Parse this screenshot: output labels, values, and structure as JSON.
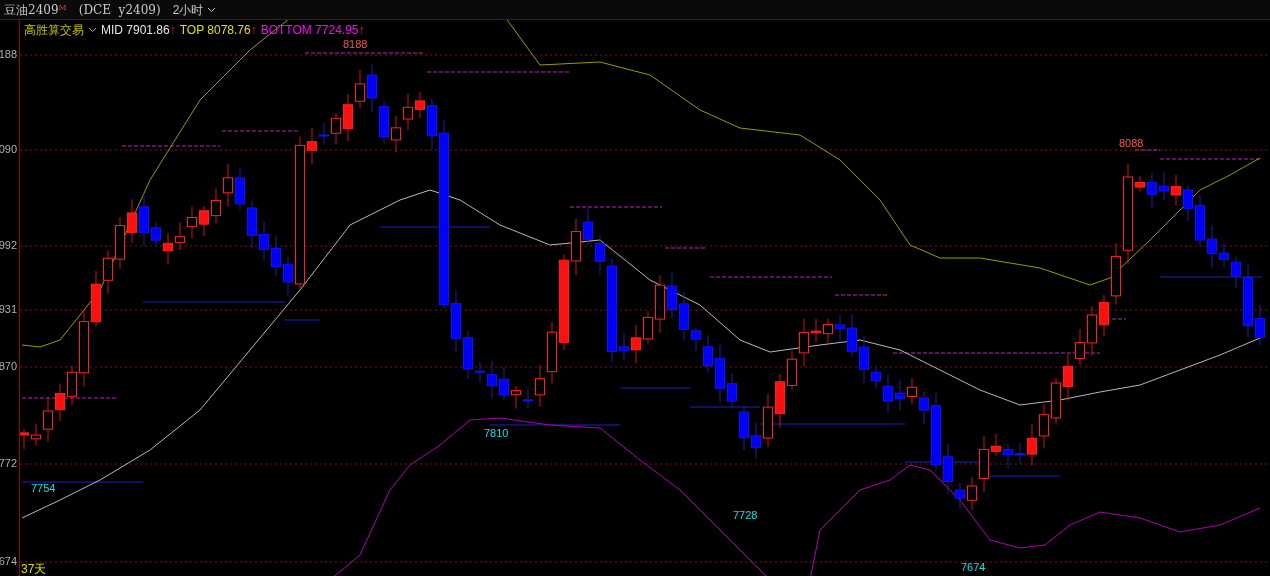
{
  "header": {
    "symbol": "豆油2409",
    "badge": "M",
    "contract": "(DCE  y2409)",
    "period": "2小时"
  },
  "indicator": {
    "name": "高胜算交易",
    "readouts": [
      {
        "label": "MID 7901.86",
        "arrow": "↑",
        "color": "#e6e6e6"
      },
      {
        "label": "TOP 8078.76",
        "arrow": "↑",
        "color": "#e0e000"
      },
      {
        "label": "BOTTOM 7724.95",
        "arrow": "↑",
        "color": "#ff00ff"
      }
    ]
  },
  "y_axis": {
    "labels": [
      "188",
      "090",
      "992",
      "931",
      "870",
      "772",
      "674"
    ]
  },
  "chart": {
    "annotations": [
      {
        "text": "8188",
        "kind": "high"
      },
      {
        "text": "8088",
        "kind": "high"
      },
      {
        "text": "7754",
        "kind": "low"
      },
      {
        "text": "7810",
        "kind": "low"
      },
      {
        "text": "7728",
        "kind": "low"
      },
      {
        "text": "7674",
        "kind": "low"
      }
    ]
  },
  "footer": {
    "days": "37天"
  }
}
